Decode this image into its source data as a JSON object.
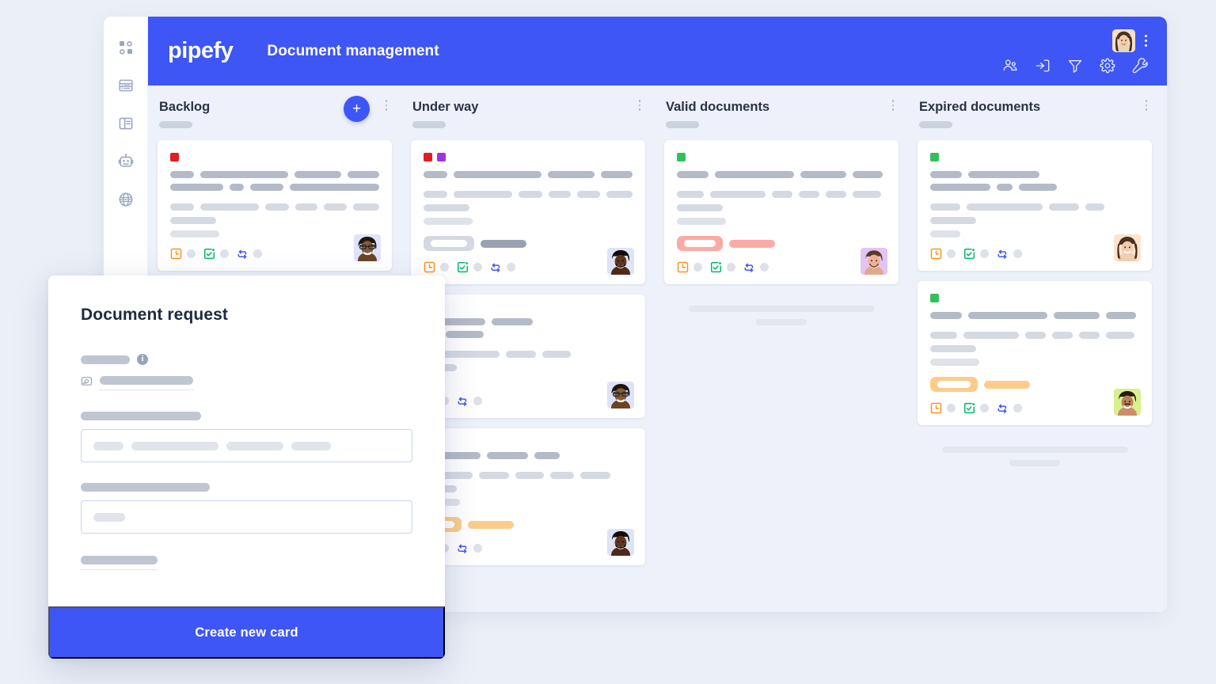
{
  "app": {
    "brand": "pipefy",
    "board_title": "Document management"
  },
  "sidebar": {
    "items": [
      {
        "icon": "dashboard-grid-icon",
        "label": "Dashboard"
      },
      {
        "icon": "database-icon",
        "label": "Database"
      },
      {
        "icon": "layout-panel-icon",
        "label": "Templates"
      },
      {
        "icon": "robot-icon",
        "label": "Automations"
      },
      {
        "icon": "globe-icon",
        "label": "Portals"
      }
    ]
  },
  "topbar": {
    "tools": [
      {
        "icon": "members-icon",
        "label": "Members"
      },
      {
        "icon": "inbox-in-icon",
        "label": "Inbox"
      },
      {
        "icon": "filter-icon",
        "label": "Filter"
      },
      {
        "icon": "gear-icon",
        "label": "Settings"
      },
      {
        "icon": "wrench-icon",
        "label": "Tools"
      }
    ],
    "avatar_label": "User avatar",
    "kebab_label": "More options"
  },
  "board": {
    "add_card_label": "+",
    "columns": [
      {
        "title": "Backlog",
        "kebab_label": "Column options",
        "has_add_button": true,
        "cards": [
          {
            "tags": [
              "#e02020",
              null
            ],
            "avatar_tint": "#dfe3f7",
            "avatar_skin": "#7a4a2a",
            "pill_style": null,
            "line_widths_top": [
              [
                40,
                145,
                78,
                52
              ],
              [
                76,
                20,
                48,
                128
              ]
            ],
            "line_widths_mid": [
              [
                38,
                96,
                38,
                36,
                38,
                42
              ],
              [
                58
              ],
              [
                62
              ]
            ],
            "footer_icons": [
              "clock-icon",
              "calendar-check-icon",
              "connection-icon"
            ]
          }
        ],
        "ghost_rows": []
      },
      {
        "title": "Under way",
        "kebab_label": "Column options",
        "has_add_button": false,
        "cards": [
          {
            "tags": [
              "#e02020",
              "#a133e0"
            ],
            "avatar_tint": "#dfe3f7",
            "avatar_skin": "#4d2a18",
            "pill_style": "gray",
            "line_widths_top": [
              [
                40,
                145,
                78,
                52
              ]
            ],
            "line_widths_mid": [
              [
                38,
                96,
                38,
                36,
                38,
                42
              ],
              [
                58
              ],
              [
                62
              ]
            ],
            "footer_icons": [
              "clock-icon",
              "calendar-check-icon",
              "connection-icon"
            ]
          },
          {
            "tags": [],
            "avatar_tint": "#dfe3f7",
            "avatar_skin": "#7a4a2a",
            "pill_style": null,
            "line_widths_top": [
              [
                78,
                52
              ],
              [
                20,
                48
              ]
            ],
            "line_widths_mid": [
              [
                96,
                38,
                36
              ],
              [
                42
              ],
              [
                20
              ]
            ],
            "footer_icons": [
              "calendar-check-icon",
              "connection-icon"
            ]
          },
          {
            "tags": [],
            "avatar_tint": "#dfe3f7",
            "avatar_skin": "#4d2a18",
            "pill_style": "amber",
            "line_widths_top": [
              [
                72,
                52,
                32
              ]
            ],
            "line_widths_mid": [
              [
                62,
                38,
                36,
                30,
                38
              ],
              [
                42
              ],
              [
                46
              ]
            ],
            "footer_icons": [
              "calendar-check-icon",
              "connection-icon"
            ]
          }
        ],
        "ghost_rows": []
      },
      {
        "title": "Valid documents",
        "kebab_label": "Column options",
        "has_add_button": false,
        "cards": [
          {
            "tags": [
              "#2fc25b"
            ],
            "avatar_tint": "#e5c8f5",
            "avatar_skin": "#e0a98e",
            "pill_style": "red",
            "line_widths_top": [
              [
                40,
                145,
                78,
                52
              ]
            ],
            "line_widths_mid": [
              [
                38,
                96,
                38,
                36,
                38,
                42
              ],
              [
                58
              ],
              [
                62
              ]
            ],
            "footer_icons": [
              "clock-icon",
              "calendar-check-icon",
              "connection-icon"
            ]
          }
        ],
        "ghost_rows": [
          1
        ]
      },
      {
        "title": "Expired documents",
        "kebab_label": "Column options",
        "has_add_button": false,
        "cards": [
          {
            "tags": [
              "#2fc25b"
            ],
            "avatar_tint": "#fbe5cf",
            "avatar_skin": "#c98e6a",
            "pill_style": null,
            "line_widths_top": [
              [
                40,
                90
              ],
              [
                76,
                20,
                48
              ]
            ],
            "line_widths_mid": [
              [
                38,
                96,
                38,
                24
              ],
              [
                58
              ],
              [
                38
              ]
            ],
            "footer_icons": [
              "clock-icon",
              "calendar-check-icon",
              "connection-icon"
            ]
          },
          {
            "tags": [
              "#2fc25b"
            ],
            "avatar_tint": "#d9f08e",
            "avatar_skin": "#8a5a36",
            "pill_style": "amber",
            "line_widths_top": [
              [
                40,
                145,
                78,
                52
              ]
            ],
            "line_widths_mid": [
              [
                38,
                96,
                38,
                36,
                38,
                42
              ],
              [
                58
              ],
              [
                62
              ]
            ],
            "footer_icons": [
              "clock-icon",
              "calendar-check-icon",
              "connection-icon"
            ]
          }
        ],
        "ghost_rows": [
          1
        ]
      }
    ]
  },
  "modal": {
    "title": "Document request",
    "submit_label": "Create new card",
    "fields": [
      {
        "name": "attachment-field",
        "label_width": 78,
        "has_info_icon": true,
        "icon": "image-attachment-icon",
        "value_width": 120,
        "dotted": true
      },
      {
        "name": "tags-field",
        "label_width": 152,
        "input_chips": [
          38,
          110,
          72,
          50
        ]
      },
      {
        "name": "description-field",
        "label_width": 163,
        "input_chips": [
          40
        ]
      },
      {
        "name": "footer-field",
        "label_width": 97,
        "dotted": true
      }
    ]
  },
  "colors": {
    "brand_blue": "#3d56f5",
    "page_bg": "#ebeff7",
    "board_bg": "#eef1f9",
    "card_bg": "#ffffff",
    "title_text": "#2b3248",
    "skeleton_dark": "#b4bac6",
    "skeleton_light": "#d5d9e1",
    "tag_red": "#e02020",
    "tag_purple": "#a133e0",
    "tag_green": "#2fc25b",
    "icon_orange": "#f7941e",
    "icon_green": "#00b96b",
    "icon_blue": "#3d56f5"
  }
}
